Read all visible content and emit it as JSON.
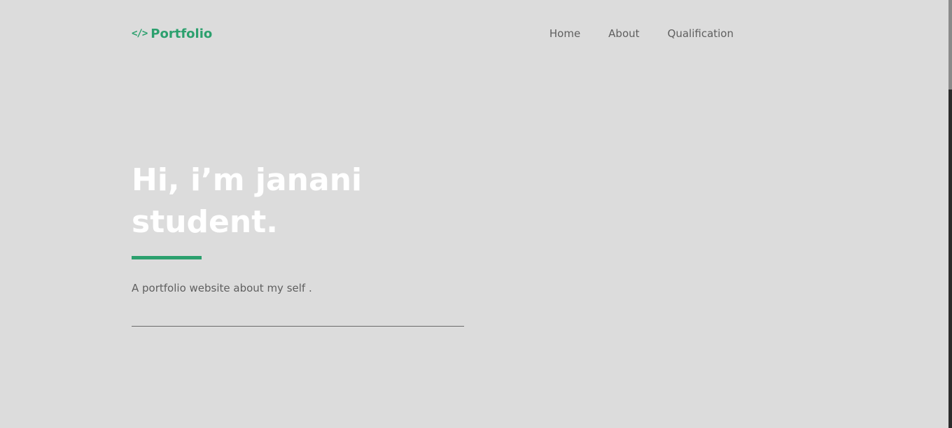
{
  "header": {
    "logo_icon": "</>",
    "logo_text": "Portfolio",
    "nav": [
      "Home",
      "About",
      "Qualification"
    ]
  },
  "hero": {
    "title_line1": "Hi, i’m janani",
    "title_line2": "student.",
    "description": "A portfolio website about my self ."
  },
  "colors": {
    "accent": "#2ca06e",
    "background": "#dcdcdc",
    "text_muted": "#5f5f5f",
    "title": "#ffffff"
  }
}
